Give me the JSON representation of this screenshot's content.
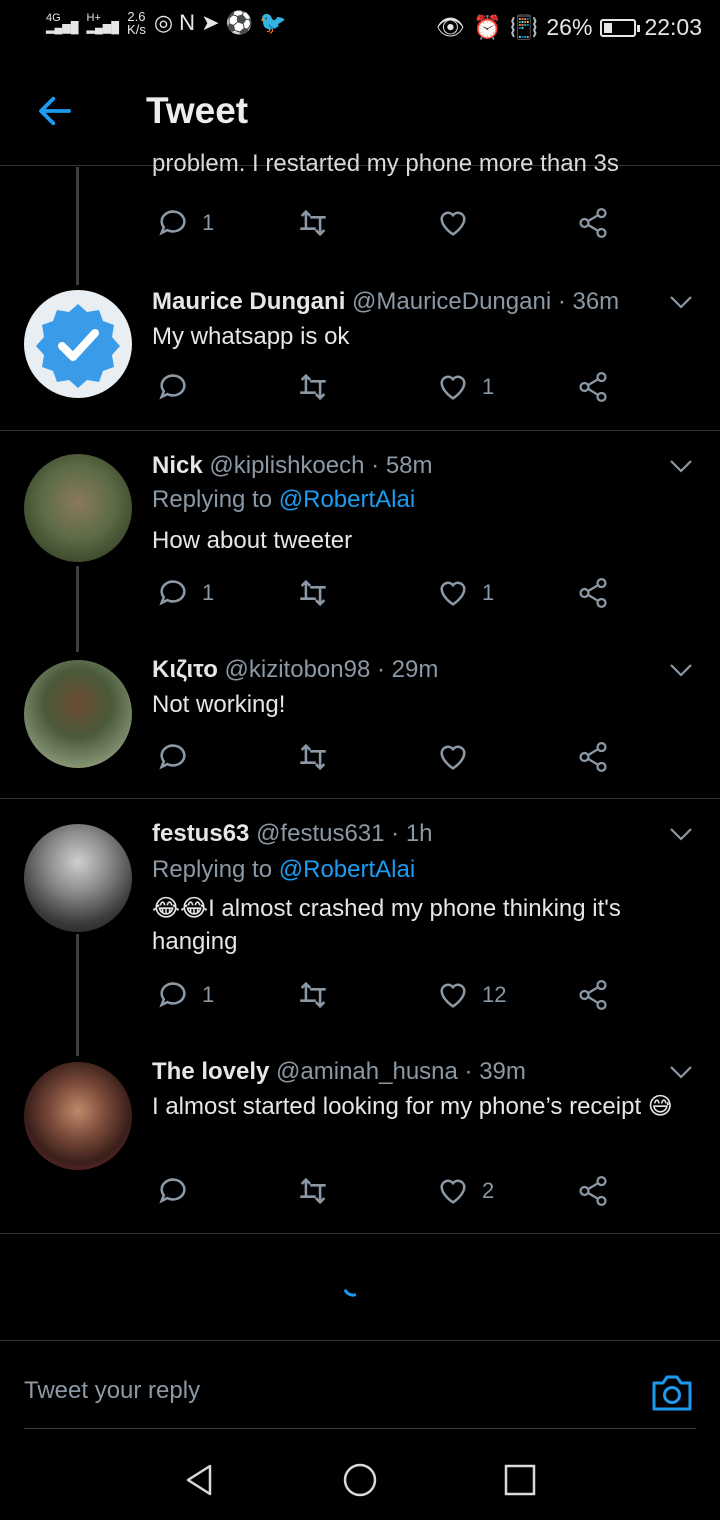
{
  "status_bar": {
    "network": "4G",
    "network2": "H+",
    "speed": "2.6",
    "speed_unit": "K/s",
    "battery": "26%",
    "battery_level": 0.26,
    "time": "22:03"
  },
  "header": {
    "title": "Tweet"
  },
  "partial_tweet": {
    "text": "problem. I restarted my phone more than 3s",
    "replies": "1",
    "retweets": "",
    "likes": ""
  },
  "tweets": [
    {
      "name": "Maurice Dungani",
      "handle": "@MauriceDungani",
      "time": "· 36m",
      "replying_to": "",
      "text": "My whatsapp is ok",
      "replies": "",
      "retweets": "",
      "likes": "1"
    },
    {
      "name": "Nick",
      "handle": "@kiplishkoech",
      "time": "· 58m",
      "replying_prefix": "Replying to",
      "replying_to": "@RobertAlai",
      "text": "How about tweeter",
      "replies": "1",
      "retweets": "",
      "likes": "1"
    },
    {
      "name": "Κιζιτο",
      "handle": "@kizitobon98",
      "time": "· 29m",
      "replying_to": "",
      "text": "Not working!",
      "replies": "",
      "retweets": "",
      "likes": ""
    },
    {
      "name": "festus63",
      "handle": "@festus631",
      "time": "· 1h",
      "replying_prefix": "Replying to",
      "replying_to": "@RobertAlai",
      "text": "😂😂I almost crashed my phone thinking it's hanging",
      "replies": "1",
      "retweets": "",
      "likes": "12"
    },
    {
      "name": "The lovely",
      "handle": "@aminah_husna",
      "time": "· 39m",
      "replying_to": "",
      "text": "I almost started looking for my phone’s receipt 😅",
      "replies": "",
      "retweets": "",
      "likes": "2"
    }
  ],
  "compose": {
    "placeholder": "Tweet your reply"
  },
  "colors": {
    "accent": "#1d9bf0",
    "background": "#000000",
    "muted": "#8b98a5"
  }
}
